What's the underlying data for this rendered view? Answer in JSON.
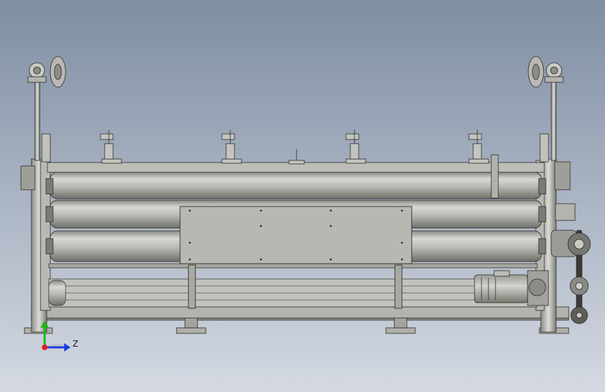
{
  "viewport": {
    "background_top": "#7f8ea3",
    "background_bottom": "#d4d9e2"
  },
  "machine": {
    "roller_count": 3,
    "top_clamp_count": 4,
    "colors": {
      "metal_light": "#c9c9c4",
      "metal_mid": "#a8a8a2",
      "metal_dark": "#6d6d68",
      "outline": "#2a2a2a"
    }
  },
  "triad": {
    "z_label": "Z",
    "x_color": "#e02020",
    "y_color": "#18b818",
    "z_color": "#1f3fe0"
  }
}
